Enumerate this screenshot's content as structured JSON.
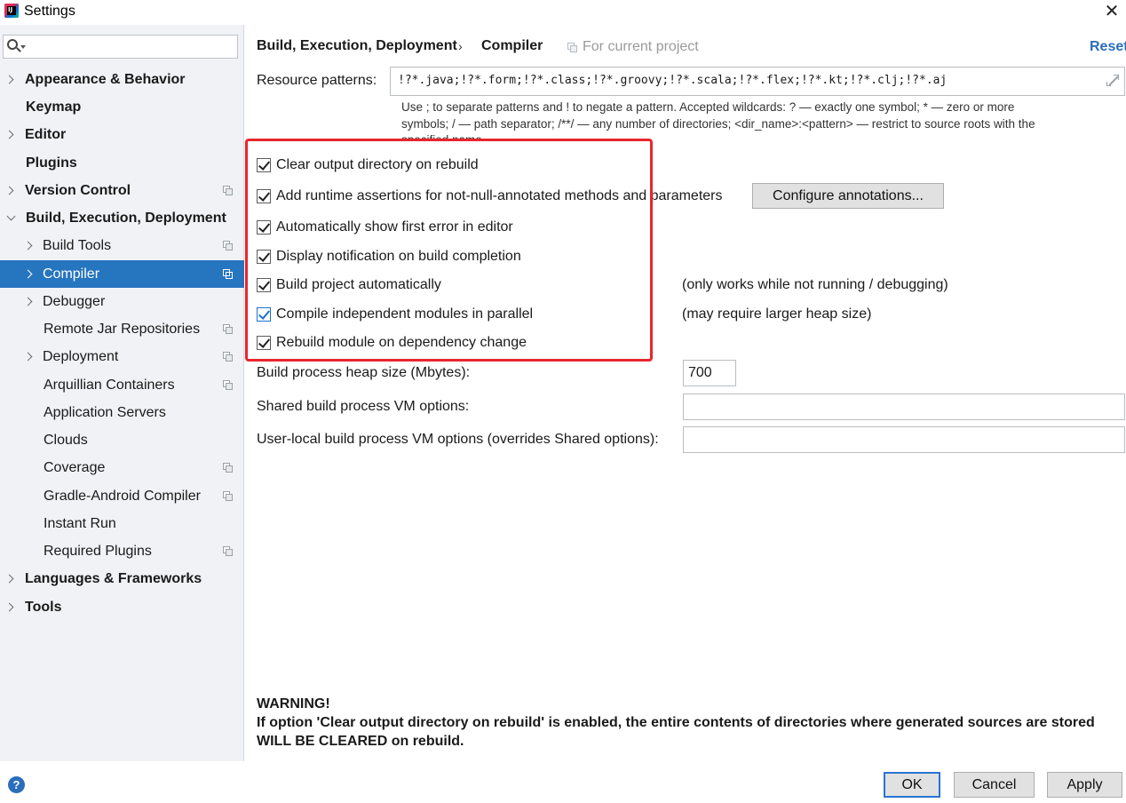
{
  "window": {
    "title": "Settings"
  },
  "search": {
    "value": ""
  },
  "sidebar": {
    "items": [
      {
        "label": "Appearance & Behavior"
      },
      {
        "label": "Keymap"
      },
      {
        "label": "Editor"
      },
      {
        "label": "Plugins"
      },
      {
        "label": "Version Control"
      },
      {
        "label": "Build, Execution, Deployment"
      },
      {
        "label": "Build Tools"
      },
      {
        "label": "Compiler"
      },
      {
        "label": "Debugger"
      },
      {
        "label": "Remote Jar Repositories"
      },
      {
        "label": "Deployment"
      },
      {
        "label": "Arquillian Containers"
      },
      {
        "label": "Application Servers"
      },
      {
        "label": "Clouds"
      },
      {
        "label": "Coverage"
      },
      {
        "label": "Gradle-Android Compiler"
      },
      {
        "label": "Instant Run"
      },
      {
        "label": "Required Plugins"
      },
      {
        "label": "Languages & Frameworks"
      },
      {
        "label": "Tools"
      }
    ]
  },
  "header": {
    "breadcrumb_parent": "Build, Execution, Deployment",
    "breadcrumb_separator": "›",
    "breadcrumb_page": "Compiler",
    "scope_note": "For current project",
    "reset_label": "Reset"
  },
  "resource": {
    "label": "Resource patterns:",
    "value": "!?*.java;!?*.form;!?*.class;!?*.groovy;!?*.scala;!?*.flex;!?*.kt;!?*.clj;!?*.aj"
  },
  "hint": {
    "line1": "Use ; to separate patterns and ! to negate a pattern. Accepted wildcards: ? — exactly one symbol; * — zero or more",
    "line2": "symbols; / — path separator; /**/ — any number of directories; <dir_name>:<pattern> — restrict to source roots with the",
    "line3": "specified name"
  },
  "options": {
    "clear_output": {
      "label": "Clear output directory on rebuild",
      "checked": true
    },
    "runtime_assertions": {
      "label": "Add runtime assertions for not-null-annotated methods and parameters",
      "checked": true
    },
    "configure_annotations_label": "Configure annotations...",
    "show_first_error": {
      "label": "Automatically show first error in editor",
      "checked": true
    },
    "display_notification": {
      "label": "Display notification on build completion",
      "checked": true
    },
    "build_automatically": {
      "label": "Build project automatically",
      "checked": true,
      "note": "(only works while not running / debugging)"
    },
    "compile_parallel": {
      "label": "Compile independent modules in parallel",
      "checked": true,
      "note": "(may require larger heap size)"
    },
    "rebuild_on_dependency": {
      "label": "Rebuild module on dependency change",
      "checked": true
    }
  },
  "fields": {
    "heap_label": "Build process heap size (Mbytes):",
    "heap_value": "700",
    "shared_vm_label": "Shared build process VM options:",
    "shared_vm_value": "",
    "user_vm_label": "User-local build process VM options (overrides Shared options):",
    "user_vm_value": ""
  },
  "warning": {
    "title": "WARNING!",
    "line1": "If option 'Clear output directory on rebuild' is enabled, the entire contents of directories where generated sources are stored",
    "line2": "WILL BE CLEARED on rebuild."
  },
  "footer": {
    "ok_label": "OK",
    "cancel_label": "Cancel",
    "apply_label": "Apply",
    "help_label": "?"
  },
  "colors": {
    "selection": "#2675bf",
    "link": "#2a6ebc",
    "highlight_box": "#e8262d",
    "sidebar_bg": "#f0f2f5"
  }
}
